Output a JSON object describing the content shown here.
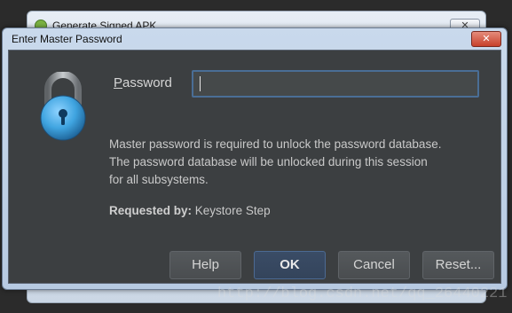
{
  "background_window": {
    "title": "Generate Signed APK",
    "close_label": "✕"
  },
  "dialog": {
    "title": "Enter Master Password",
    "close_label": "✕",
    "password_label_mnemonic": "P",
    "password_label_rest": "assword",
    "password_value": "",
    "message_lines": [
      "Master password is required to unlock the password database.",
      "The password database will be unlocked during this session",
      "for all subsystems."
    ],
    "requested_by_label": "Requested by:",
    "requested_by_value": "Keystore Step",
    "buttons": {
      "help": "Help",
      "ok": "OK",
      "cancel": "Cancel",
      "reset": "Reset..."
    }
  },
  "watermark": "http://blog.csdn.net/qq_26440221",
  "icons": {
    "lock": "lock-icon"
  },
  "colors": {
    "content_bg": "#3c3f41",
    "title_bar": "#c9d9ec",
    "close_button": "#c7412c",
    "lock_body": "#3fa4e0",
    "input_border": "#4a6e96"
  }
}
